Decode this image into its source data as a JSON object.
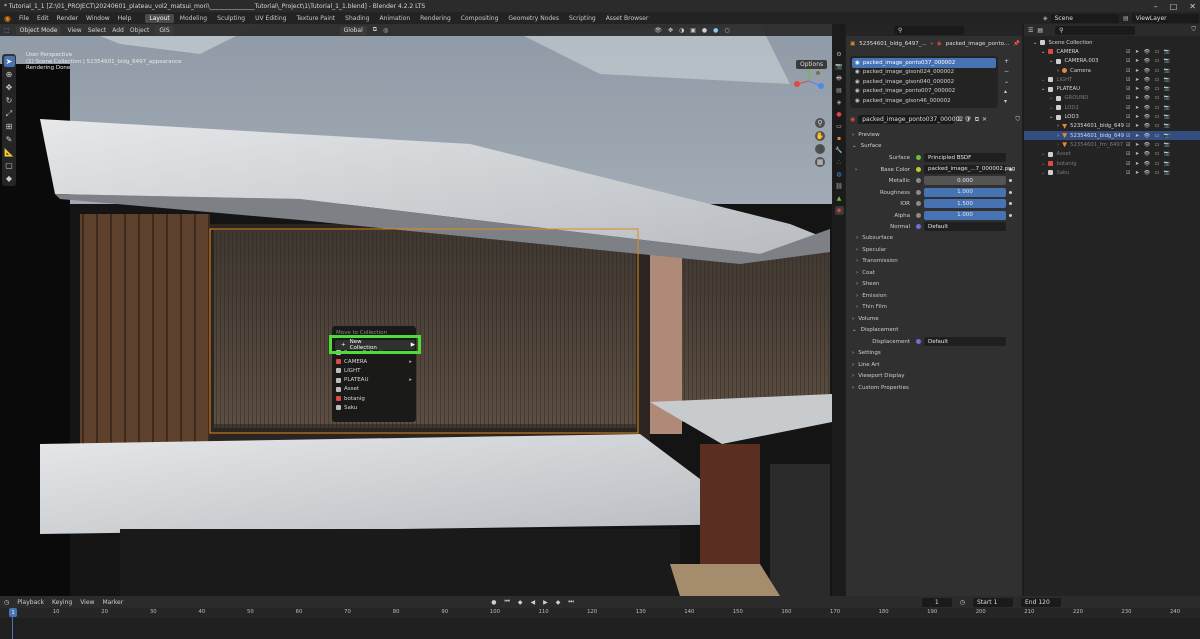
{
  "app": {
    "title": "* Tutorial_1_1 [Z:\\01_PROJECT\\20240601_plateau_vol2_matsui_mori\\_______________Tutorial\\_Project\\1\\Tutorial_1_1.blend] - Blender 4.2.2 LTS"
  },
  "menu": [
    "File",
    "Edit",
    "Render",
    "Window",
    "Help"
  ],
  "workspaces": [
    {
      "label": "Layout",
      "active": true
    },
    {
      "label": "Modeling"
    },
    {
      "label": "Sculpting"
    },
    {
      "label": "UV Editing"
    },
    {
      "label": "Texture Paint"
    },
    {
      "label": "Shading"
    },
    {
      "label": "Animation"
    },
    {
      "label": "Rendering"
    },
    {
      "label": "Compositing"
    },
    {
      "label": "Geometry Nodes"
    },
    {
      "label": "Scripting"
    },
    {
      "label": "Asset Browser"
    }
  ],
  "scene": "Scene",
  "view_layer": "ViewLayer",
  "viewport": {
    "mode": "Object Mode",
    "menus": [
      "View",
      "Select",
      "Add",
      "Object"
    ],
    "gis": "GIS",
    "orientation": "Global",
    "options": "Options",
    "info_lines": [
      "User Perspective",
      "(1) Scene Collection | 52354601_bldg_6497_appearance",
      "Rendering Done"
    ]
  },
  "context_menu": {
    "title": "Move to Collection",
    "new_collection": "New Collection",
    "items": [
      {
        "label": "Scene Collection",
        "color": "#bdbdbd",
        "arrow": false
      },
      {
        "label": "CAMERA",
        "color": "#e04848",
        "arrow": true
      },
      {
        "label": "LIGHT",
        "color": "#bdbdbd",
        "arrow": false
      },
      {
        "label": "PLATEAU",
        "color": "#bdbdbd",
        "arrow": true
      },
      {
        "label": "Asset",
        "color": "#bdbdbd",
        "arrow": false
      },
      {
        "label": "botanig",
        "color": "#e04848",
        "arrow": false
      },
      {
        "label": "Saku",
        "color": "#bdbdbd",
        "arrow": false
      }
    ]
  },
  "properties": {
    "breadcrumb_object": "52354601_bldg_6497_...",
    "breadcrumb_material": "packed_image_ponto...",
    "materials": [
      {
        "label": "packed_image_ponto037_000002",
        "selected": true
      },
      {
        "label": "packed_image_gison024_000002"
      },
      {
        "label": "packed_image_gison040_000002"
      },
      {
        "label": "packed_image_ponto007_000002"
      },
      {
        "label": "packed_image_gison46_000002"
      }
    ],
    "active_material": "packed_image_ponto037_000002",
    "sections": {
      "preview": "Preview",
      "surface": "Surface",
      "volume": "Volume",
      "displacement": "Displacement",
      "settings": "Settings",
      "line_art": "Line Art",
      "viewport_display": "Viewport Display",
      "custom_properties": "Custom Properties"
    },
    "surface": {
      "surface_label": "Surface",
      "surface_value": "Principled BSDF",
      "base_color_label": "Base Color",
      "base_color_value": "packed_image_...7_000002.png",
      "metallic_label": "Metallic",
      "metallic_value": "0.000",
      "roughness_label": "Roughness",
      "roughness_value": "1.000",
      "ior_label": "IOR",
      "ior_value": "1.500",
      "alpha_label": "Alpha",
      "alpha_value": "1.000",
      "normal_label": "Normal",
      "normal_value": "Default"
    },
    "subsections": [
      "Subsurface",
      "Specular",
      "Transmission",
      "Coat",
      "Sheen",
      "Emission",
      "Thin Film"
    ],
    "displacement": {
      "label": "Displacement",
      "value": "Default"
    }
  },
  "outliner": {
    "rows": [
      {
        "label": "Scene Collection",
        "indent": 0,
        "icon": "collection",
        "color": "#cfcfcf"
      },
      {
        "label": "CAMERA",
        "indent": 1,
        "icon": "collection",
        "color": "#e04848",
        "vis": true
      },
      {
        "label": "CAMERA.003",
        "indent": 2,
        "icon": "collection",
        "color": "#cfcfcf",
        "vis": true
      },
      {
        "label": "Camera",
        "indent": 3,
        "icon": "camera",
        "color": "#e08a3a",
        "vis": true
      },
      {
        "label": "LIGHT",
        "indent": 1,
        "icon": "collection",
        "color": "#cfcfcf",
        "vis": true,
        "dim": true
      },
      {
        "label": "PLATEAU",
        "indent": 1,
        "icon": "collection",
        "color": "#cfcfcf",
        "vis": true
      },
      {
        "label": "GROUND",
        "indent": 2,
        "icon": "collection",
        "color": "#cfcfcf",
        "vis": true,
        "dim": true
      },
      {
        "label": "LOD2",
        "indent": 2,
        "icon": "collection",
        "color": "#cfcfcf",
        "vis": true,
        "dim": true
      },
      {
        "label": "LOD3",
        "indent": 2,
        "icon": "collection",
        "color": "#cfcfcf",
        "vis": true
      },
      {
        "label": "52354601_bldg_649",
        "indent": 3,
        "icon": "mesh",
        "color": "#e08a3a",
        "vis": true
      },
      {
        "label": "52354601_bldg_649",
        "indent": 3,
        "icon": "mesh",
        "color": "#e08a3a",
        "vis": true,
        "selected": true
      },
      {
        "label": "52354601_frn_6497",
        "indent": 3,
        "icon": "mesh",
        "color": "#e08a3a",
        "vis": true,
        "dim": true
      },
      {
        "label": "Asset",
        "indent": 1,
        "icon": "collection",
        "color": "#cfcfcf",
        "vis": true,
        "dim": true
      },
      {
        "label": "botanig",
        "indent": 1,
        "icon": "collection",
        "color": "#e04848",
        "vis": true,
        "dim": true
      },
      {
        "label": "Saku",
        "indent": 1,
        "icon": "collection",
        "color": "#cfcfcf",
        "vis": true,
        "dim": true
      }
    ]
  },
  "timeline": {
    "menus": [
      "Playback",
      "Keying",
      "View",
      "Marker"
    ],
    "current_frame": "1",
    "start_label": "Start",
    "start": "1",
    "end_label": "End",
    "end": "120",
    "ticks": [
      "1",
      "10",
      "20",
      "30",
      "40",
      "50",
      "60",
      "70",
      "80",
      "90",
      "100",
      "110",
      "120",
      "130",
      "140",
      "150",
      "160",
      "170",
      "180",
      "190",
      "200",
      "210",
      "220",
      "230",
      "240"
    ]
  }
}
